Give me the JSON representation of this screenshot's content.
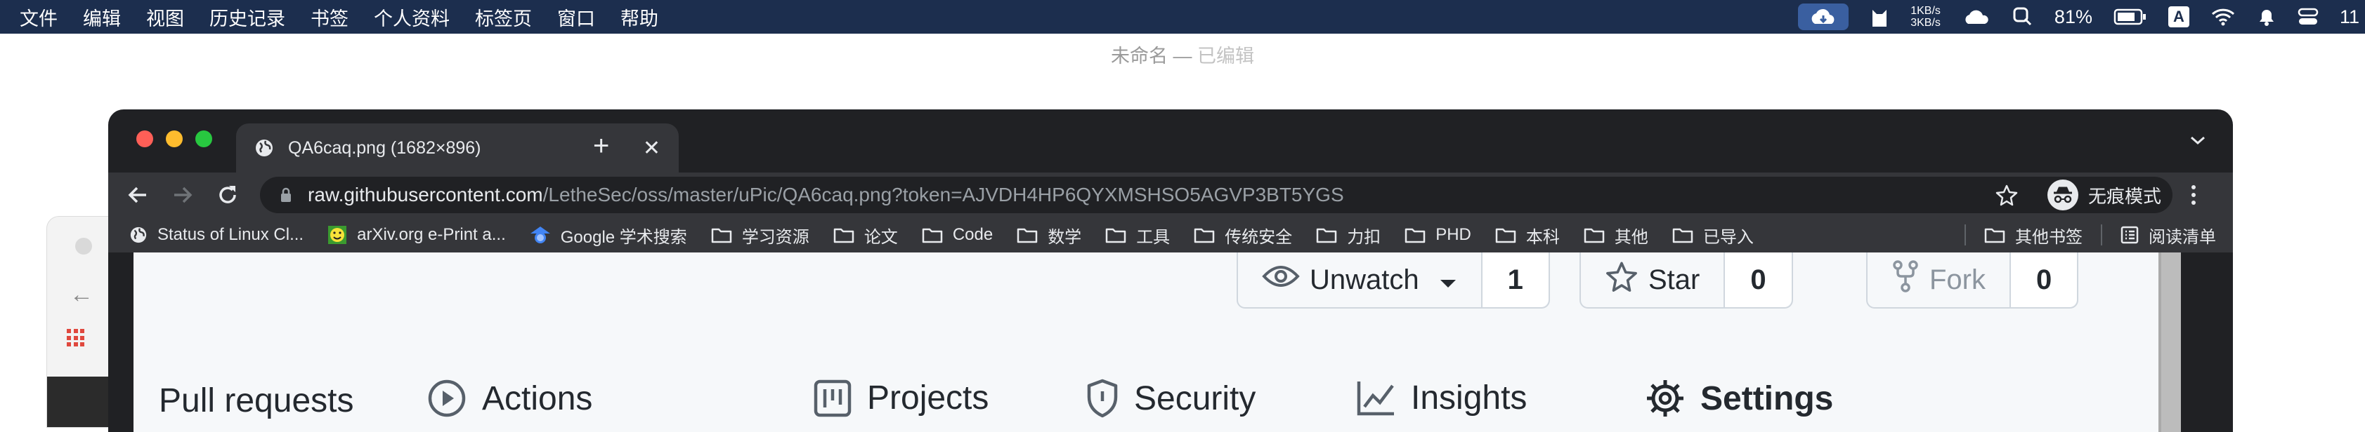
{
  "menubar": {
    "items": [
      "文件",
      "编辑",
      "视图",
      "历史记录",
      "书签",
      "个人资料",
      "标签页",
      "窗口",
      "帮助"
    ],
    "net_up": "1KB/s",
    "net_down": "3KB/s",
    "battery": "81%",
    "input_method": "A",
    "clock": "11"
  },
  "desktop": {
    "doc_title": "未命名",
    "doc_sep": " — ",
    "doc_state": "已编辑"
  },
  "browser": {
    "tab_title": "QA6caq.png (1682×896)",
    "url_host": "raw.githubusercontent.com",
    "url_path": "/LetheSec/oss/master/uPic/QA6caq.png?token=AJVDH4HP6QYXMSHSO5AGVP3BT5YGS",
    "incognito_label": "无痕模式",
    "bookmarks": [
      {
        "label": "Status of Linux Cl...",
        "icon": "globe-icon"
      },
      {
        "label": "arXiv.org e-Print a...",
        "icon": "arxiv-icon"
      },
      {
        "label": "Google 学术搜索",
        "icon": "scholar-icon"
      },
      {
        "label": "学习资源",
        "icon": "folder-icon"
      },
      {
        "label": "论文",
        "icon": "folder-icon"
      },
      {
        "label": "Code",
        "icon": "folder-icon"
      },
      {
        "label": "数学",
        "icon": "folder-icon"
      },
      {
        "label": "工具",
        "icon": "folder-icon"
      },
      {
        "label": "传统安全",
        "icon": "folder-icon"
      },
      {
        "label": "力扣",
        "icon": "folder-icon"
      },
      {
        "label": "PHD",
        "icon": "folder-icon"
      },
      {
        "label": "本科",
        "icon": "folder-icon"
      },
      {
        "label": "其他",
        "icon": "folder-icon"
      },
      {
        "label": "已导入",
        "icon": "folder-icon"
      }
    ],
    "other_bookmarks": "其他书签",
    "reading_list": "阅读清单"
  },
  "github": {
    "unwatch_label": "Unwatch",
    "unwatch_count": "1",
    "star_label": "Star",
    "star_count": "0",
    "fork_label": "Fork",
    "fork_count": "0",
    "tabs": [
      {
        "label": "Pull requests",
        "icon": ""
      },
      {
        "label": "Actions",
        "icon": "play-icon"
      },
      {
        "label": "Projects",
        "icon": "project-icon"
      },
      {
        "label": "Security",
        "icon": "shield-icon"
      },
      {
        "label": "Insights",
        "icon": "graph-icon"
      },
      {
        "label": "Settings",
        "icon": "gear-icon"
      }
    ]
  },
  "colors": {
    "menubar_bg": "#1c2e4e",
    "chrome_frame": "#202124",
    "chrome_toolbar": "#35363a",
    "traffic_red": "#ff5f57",
    "traffic_yellow": "#febc2e",
    "traffic_green": "#28c840",
    "page_bg": "#f6f8fa"
  }
}
